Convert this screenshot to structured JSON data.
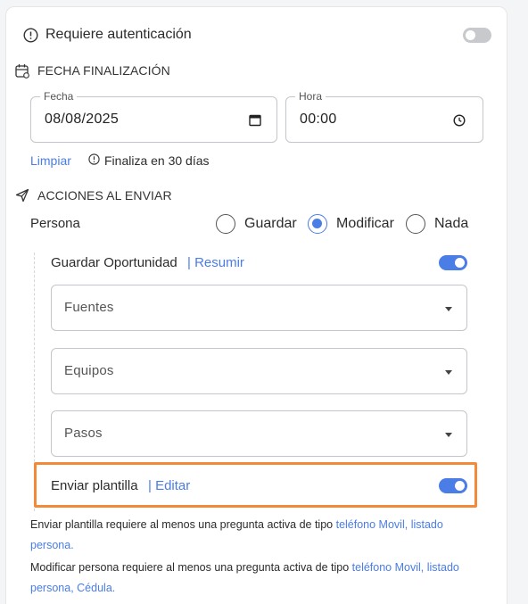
{
  "auth": {
    "label": "Requiere autenticación",
    "toggle_on": false
  },
  "fecha_finalizacion": {
    "title": "FECHA FINALIZACIÓN",
    "date": {
      "legend": "Fecha",
      "value": "08/08/2025"
    },
    "time": {
      "legend": "Hora",
      "value": "00:00"
    },
    "clear_label": "Limpiar",
    "info": "Finaliza en 30 días"
  },
  "acciones": {
    "title": "ACCIONES AL ENVIAR",
    "persona_label": "Persona",
    "options": [
      "Guardar",
      "Modificar",
      "Nada"
    ],
    "selected": "Modificar",
    "guardar_oportunidad": {
      "label": "Guardar Oportunidad",
      "link": "| Resumir",
      "toggle_on": true
    },
    "selects": [
      "Fuentes",
      "Equipos",
      "Pasos"
    ],
    "enviar_plantilla": {
      "label": "Enviar plantilla",
      "link": "| Editar",
      "toggle_on": true
    }
  },
  "notes": {
    "note1_text": "Enviar plantilla requiere al menos una pregunta activa de tipo",
    "note1_links": [
      "teléfono Movil",
      "listado persona"
    ],
    "note2_text": "Modificar persona requiere al menos una pregunta activa de tipo",
    "note2_links": [
      "teléfono Movil",
      "listado persona",
      "Cédula"
    ]
  },
  "colors": {
    "accent": "#4a7de6",
    "highlight": "#f28a3a",
    "toggle_off": "#c7c9cd"
  }
}
